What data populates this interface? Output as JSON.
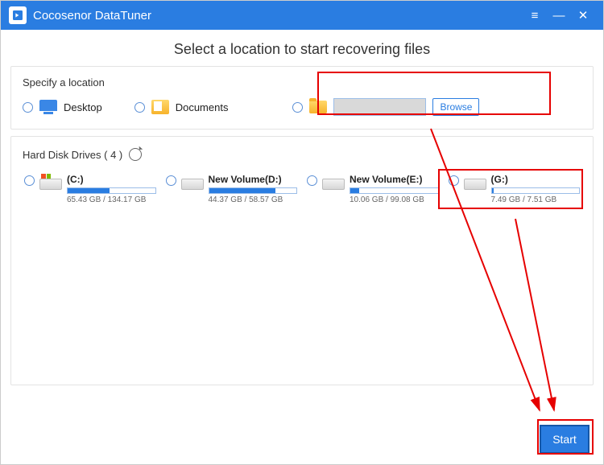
{
  "app": {
    "title": "Cocosenor DataTuner"
  },
  "heading": "Select a location to start recovering files",
  "specify": {
    "title": "Specify a location",
    "desktop": "Desktop",
    "documents": "Documents",
    "browse_btn": "Browse",
    "path_value": ""
  },
  "drives": {
    "title": "Hard Disk Drives ( 4 )",
    "list": [
      {
        "name": "(C:)",
        "size": "65.43 GB / 134.17 GB",
        "fill": 48,
        "windows": true
      },
      {
        "name": "New Volume(D:)",
        "size": "44.37 GB / 58.57 GB",
        "fill": 76,
        "windows": false
      },
      {
        "name": "New Volume(E:)",
        "size": "10.06 GB / 99.08 GB",
        "fill": 10,
        "windows": false
      },
      {
        "name": "(G:)",
        "size": "7.49 GB / 7.51 GB",
        "fill": 2,
        "windows": false
      }
    ]
  },
  "start": "Start"
}
